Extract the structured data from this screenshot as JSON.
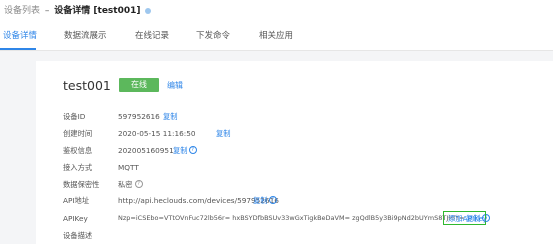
{
  "breadcrumb": {
    "parent": "设备列表",
    "separator": "–",
    "current": "设备详情 [test001]"
  },
  "tabs": [
    {
      "label": "设备详情",
      "active": true
    },
    {
      "label": "数据流展示",
      "active": false
    },
    {
      "label": "在线记录",
      "active": false
    },
    {
      "label": "下发命令",
      "active": false
    },
    {
      "label": "相关应用",
      "active": false
    }
  ],
  "device": {
    "name": "test001",
    "status": "在线",
    "edit_label": "编辑"
  },
  "fields": {
    "device_id": {
      "label": "设备ID",
      "value": "597952616",
      "action": "复制"
    },
    "created_time": {
      "label": "创建时间",
      "value": "2020-05-15 11:16:50",
      "action": "复制"
    },
    "auth_info": {
      "label": "鉴权信息",
      "value": "202005160951",
      "action": "复制"
    },
    "protocol": {
      "label": "接入方式",
      "value": "MQTT"
    },
    "privacy": {
      "label": "数据保密性",
      "value": "私密"
    },
    "api_address": {
      "label": "API地址",
      "value": "http://api.heclouds.com/devices/597952616",
      "action": "复制"
    },
    "api_key": {
      "label": "APIKey",
      "value": "Nzp=iCSEbo=VTtOVnFuc72lb56r= hxBSYDfbBSUv33wGxTigkBeDaVM= zgQdlB5y3Bi9pNd2bUYmS8TJHIY=",
      "add_label": "添加APIKey",
      "action": "复制"
    },
    "description": {
      "label": "设备描述"
    }
  },
  "colors": {
    "accent": "#2f86e8",
    "status_online": "#5cb85c",
    "highlight_box": "#2fb82f"
  }
}
